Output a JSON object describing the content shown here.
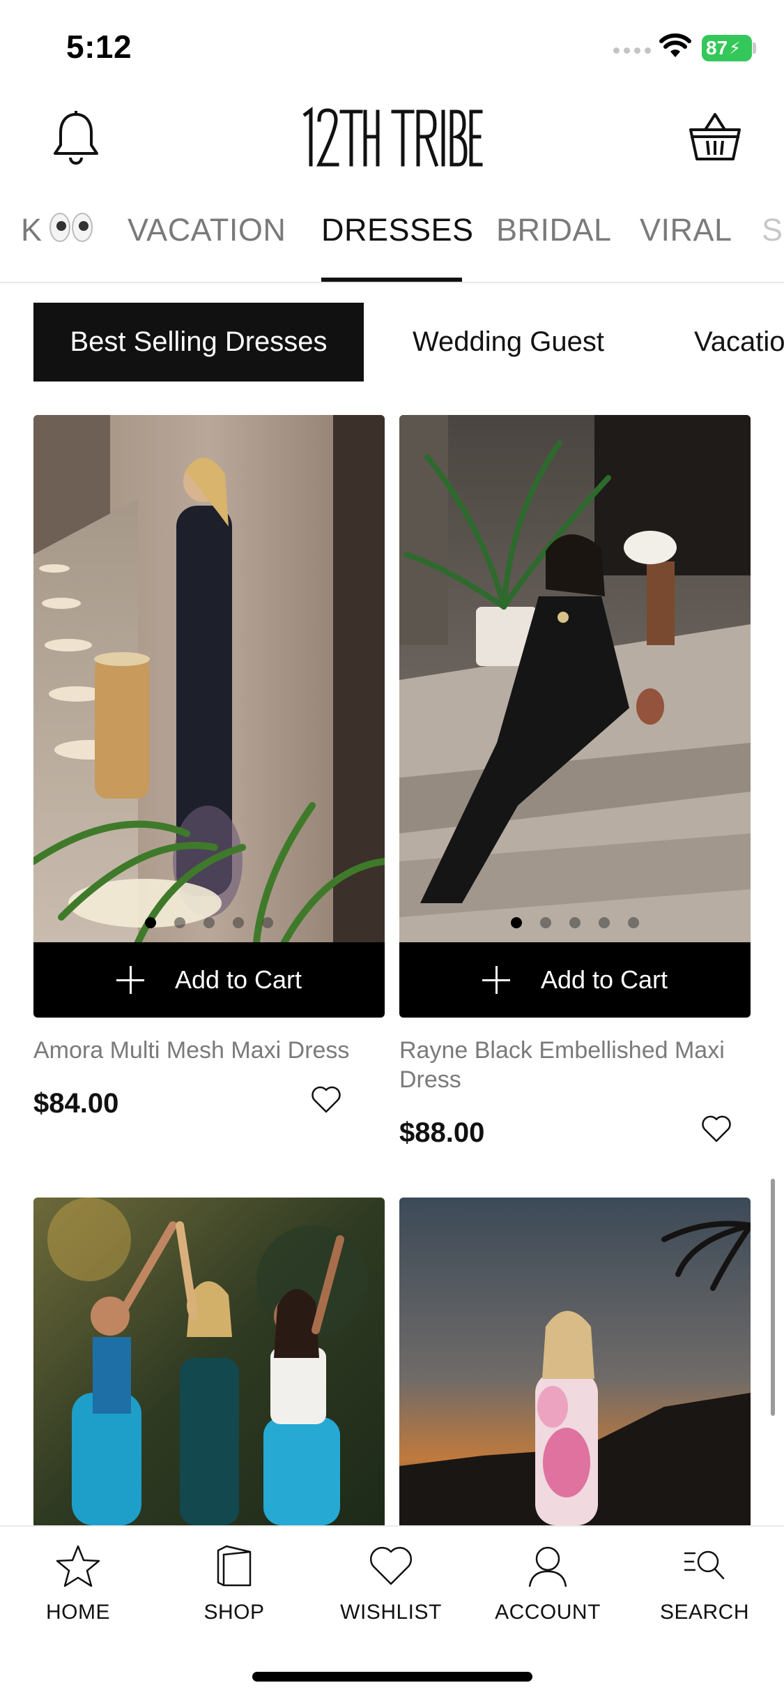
{
  "status_bar": {
    "time": "5:12",
    "battery": "87"
  },
  "header": {
    "brand": "12TH TRIBE"
  },
  "category_tabs": [
    {
      "label": "K",
      "active": false
    },
    {
      "label": "VACATION",
      "active": false
    },
    {
      "label": "DRESSES",
      "active": true
    },
    {
      "label": "BRIDAL",
      "active": false
    },
    {
      "label": "VIRAL",
      "active": false
    },
    {
      "label": "S",
      "active": false
    }
  ],
  "filter_chips": [
    {
      "label": "Best Selling Dresses",
      "active": true
    },
    {
      "label": "Wedding Guest",
      "active": false
    },
    {
      "label": "Vacatio",
      "active": false
    }
  ],
  "products": [
    {
      "name": "Amora Multi Mesh Maxi Dress",
      "price": "$84.00",
      "add_label": "Add to Cart",
      "image_count": 5,
      "image_index": 1
    },
    {
      "name": "Rayne Black Embellished Maxi Dress",
      "price": "$88.00",
      "add_label": "Add to Cart",
      "image_count": 5,
      "image_index": 1
    },
    {
      "name": "",
      "price": ""
    },
    {
      "name": "",
      "price": ""
    }
  ],
  "bottom_nav": [
    {
      "label": "HOME",
      "icon": "star-icon"
    },
    {
      "label": "SHOP",
      "icon": "shopping-bag-icon"
    },
    {
      "label": "WISHLIST",
      "icon": "heart-icon"
    },
    {
      "label": "ACCOUNT",
      "icon": "user-icon"
    },
    {
      "label": "SEARCH",
      "icon": "search-list-icon"
    }
  ],
  "colors": {
    "accent": "#000000",
    "muted_text": "#7a7a7a",
    "battery": "#34c759"
  }
}
